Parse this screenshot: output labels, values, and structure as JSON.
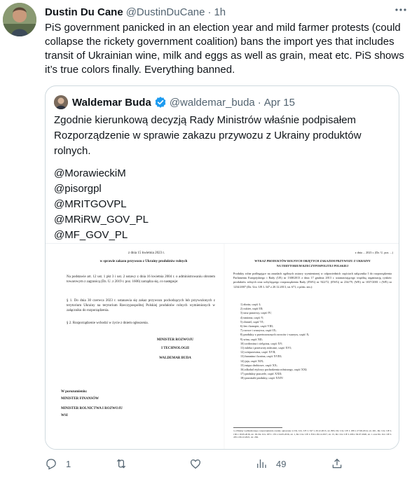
{
  "tweet": {
    "author": {
      "name": "Dustin Du Cane",
      "handle": "@DustinDuCane",
      "separator": "·",
      "time": "1h"
    },
    "text": "PiS government panicked in an election year and mild farmer protests (could collapse the rickety government coalition) bans the import yes that includes transit of Ukrainian wine, milk and eggs as well as grain, meat etc. PiS shows it’s true colors finally. Everything banned.",
    "more_icon": "more-horizontal-icon"
  },
  "quote": {
    "author": {
      "name": "Waldemar Buda",
      "handle": "@waldemar_buda",
      "separator": "·",
      "date": "Apr 15",
      "verified_icon": "verified-badge-icon"
    },
    "text": "Zgodnie kierunkową decyzją Rady Ministrów właśnie podpisałem Rozporządzenie w sprawie zakazu przywozu z Ukrainy produktów rolnych.",
    "mentions": [
      "@MorawieckiM",
      "@pisorgpl",
      "@MRITGOVPL",
      "@MRiRW_GOV_PL",
      "@MF_GOV_PL"
    ],
    "document": {
      "page1": {
        "date_line": "z dnia 15 kwietnia 2023 r.",
        "title": "w sprawie zakazu przywozu z Ukrainy produktów rolnych",
        "para1": "Na podstawie art. 12 ust. 1 pkt 3 i ust. 2 ustawy z dnia 16 kwietnia 2004 r. o administrowaniu obrotem towarowym z zagranicą (Dz. U. z 2019 r. poz. 1606) zarządza się, co następuje:",
        "para2": "§ 1. Do dnia 30 czerwca 2023 r. ustanawia się zakaz przywozu pochodzących lub przywożonych z terytorium Ukrainy na terytorium Rzeczypospolitej Polskiej produktów rolnych wymienionych w załączniku do rozporządzenia.",
        "para3": "§ 2. Rozporządzenie wchodzi w życie z dniem ogłoszenia.",
        "sig_line1": "MINISTER ROZWOJU",
        "sig_line2": "I TECHNOLOGII",
        "sig_name": "WALDEMAR BUDA",
        "agreement": "W porozumieniu:",
        "minister1": "MINISTER FINANSÓW",
        "minister2": "MINISTER ROLNICTWA I ROZWOJU",
        "minister3": "WSI"
      },
      "page2": {
        "date_line": "z dnia ... 2023 r. (Dz. U. poz. ...)",
        "title1": "WYKAZ PRODUKTÓW ROLNYCH OBJĘTYCH ZAKAZEM PRZYWOZU Z UKRAINY",
        "title2": "NA TERYTORIUM RZECZYPOSPOLITEJ POLSKIEJ",
        "intro": "Produkty rolne podlegające na zasadach ogólnych ustawy wymienionej w odpowiednich częściach załącznika I do rozporządzenia Parlamentu Europejskiego i Rady (UE) nr 1308/2013 z dnia 17 grudnia 2013 r. ustanawiającego wspólną organizację rynków produktów rolnych oraz uchylającego rozporządzenia Rady (EWG) nr 922/72, (EWG) nr 234/79, (WE) nr 1037/2001 i (WE) nr 1234/2007 (Dz. Urz. UE L 347 z 20.12.2013, str. 671, z późn. zm.):",
        "items": [
          "1) zboża, część I;",
          "2) cukier, część III;",
          "3) susz paszowy, część IV;",
          "4) nasiona, część V;",
          "5) chmiel, część VI;",
          "6) len i konopie, część VIII;",
          "7) owoce i warzywa, część IX;",
          "8) produkty z przetworzonych owoców i warzyw, część X;",
          "9) wina, część XII;",
          "10) wołowina i cielęcina, część XV;",
          "11) mleko i przetwory mleczne, część XVI;",
          "12) wieprzowina, część XVII;",
          "13) baranina i kozina, część XVIII;",
          "14) jaja, część XIX;",
          "15) mięso drobiowe, część XX;",
          "16) alkohol etylowy pochodzenia rolniczego, część XXI;",
          "17) produkty pszczele, część XXII;",
          "18) pozostałe produkty, część XXIV."
        ],
        "footnote": "1) Zmiany wymienionego rozporządzenia zostały ogłoszone w Dz. Urz. UE L 347 z 20.12.2013, str. 865, Dz. Urz. UE L 189 z 27.06.2014, str. 261, Dz. Urz. UE L 130 z 19.05.2016, str. 18, Dz. Urz. UE L 135 z 24.05.2016, str. 1, Dz. Urz. UE L 350 z 29.12.2017, str. 15, Dz. Urz. UE L 206 z 30.07.2020, str. 1 oraz Dz. Urz. UE L 435 z 06.12.2021, str. 262."
      }
    }
  },
  "actions": {
    "reply": {
      "icon": "reply-icon",
      "count": "1"
    },
    "retweet": {
      "icon": "retweet-icon",
      "count": ""
    },
    "like": {
      "icon": "like-icon",
      "count": ""
    },
    "views": {
      "icon": "views-icon",
      "count": "49"
    },
    "share": {
      "icon": "share-icon"
    }
  },
  "colors": {
    "text": "#0f1419",
    "secondary": "#536471",
    "border": "#cfd9de",
    "verified": "#1d9bf0"
  }
}
